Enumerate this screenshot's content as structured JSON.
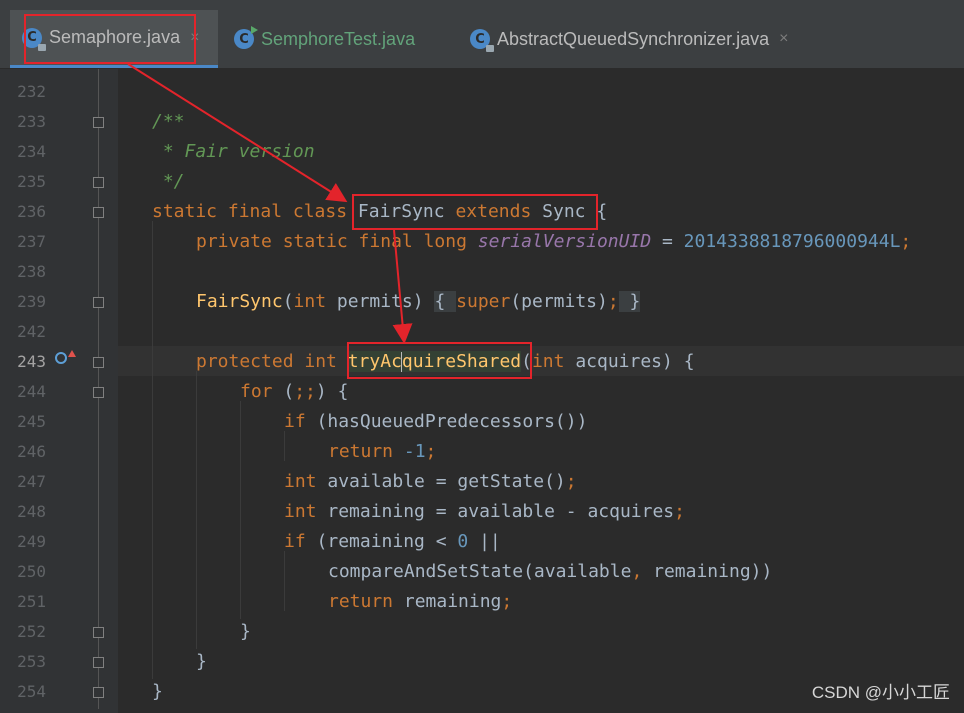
{
  "tabs": [
    {
      "label": "Semaphore.java",
      "active": true,
      "icon": "class-file-icon",
      "color": "#bbbbbb"
    },
    {
      "label": "SemphoreTest.java",
      "active": false,
      "icon": "test-class-icon",
      "color": "#62a37a"
    },
    {
      "label": "AbstractQueuedSynchronizer.java",
      "active": false,
      "icon": "class-file-icon",
      "color": "#bbbbbb"
    }
  ],
  "close_glyph": "×",
  "line_numbers": [
    "232",
    "233",
    "234",
    "235",
    "236",
    "237",
    "238",
    "239",
    "242",
    "243",
    "244",
    "245",
    "246",
    "247",
    "248",
    "249",
    "250",
    "251",
    "252",
    "253",
    "254"
  ],
  "code": {
    "l233": "/**",
    "l234": " * Fair version",
    "l235": " */",
    "l236_kw": "static final class ",
    "l236_name": "FairSync ",
    "l236_ext": "extends ",
    "l236_sup": "Sync ",
    "l236_brace": "{",
    "l237_kw": "private static final long ",
    "l237_field": "serialVersionUID",
    "l237_eq": " = ",
    "l237_num": "2014338818796000944L",
    "l237_semi": ";",
    "l239_name": "FairSync",
    "l239_paren": "(",
    "l239_int": "int ",
    "l239_rest": "permits) ",
    "l239_open": "{ ",
    "l239_super": "super",
    "l239_call": "(permits)",
    "l239_semi": ";",
    "l239_close": " }",
    "l243_kw": "protected int ",
    "l243_m1": "tryAc",
    "l243_m2": "quireShared",
    "l243_paren": "(",
    "l243_int": "int ",
    "l243_rest": "acquires) {",
    "l244_for": "for ",
    "l244_rest": "(",
    "l244_semi": ";;",
    "l244_end": ") {",
    "l245_if": "if ",
    "l245_rest": "(hasQueuedPredecessors())",
    "l246_ret": "return ",
    "l246_num": "-1",
    "l246_semi": ";",
    "l247_int": "int ",
    "l247_rest": "available = getState()",
    "l247_semi": ";",
    "l248_int": "int ",
    "l248_rest": "remaining = available - acquires",
    "l248_semi": ";",
    "l249_if": "if ",
    "l249_rest1": "(remaining < ",
    "l249_num": "0",
    "l249_rest2": " ||",
    "l250_a": "compareAndSetState(available",
    "l250_comma": ", ",
    "l250_b": "remaining))",
    "l251_ret": "return ",
    "l251_rest": "remaining",
    "l251_semi": ";",
    "l252": "}",
    "l253": "}",
    "l254": "}"
  },
  "watermark": "CSDN @小小工匠",
  "colors": {
    "keyword": "#cc7832",
    "comment": "#629755",
    "number": "#6897bb",
    "field": "#9876aa",
    "method": "#ffc66d",
    "annotation_box": "#e3242b"
  }
}
